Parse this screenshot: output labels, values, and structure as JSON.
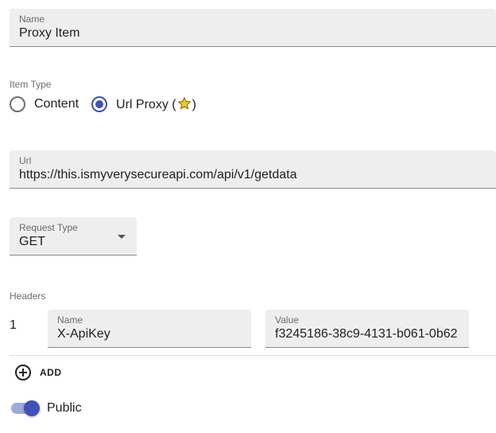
{
  "name_field": {
    "label": "Name",
    "value": "Proxy Item"
  },
  "item_type": {
    "label": "Item Type",
    "options": [
      {
        "label": "Content",
        "checked": false
      },
      {
        "label_prefix": "Url Proxy (",
        "label_suffix": ")",
        "icon": "star-icon",
        "checked": true
      }
    ]
  },
  "url_field": {
    "label": "Url",
    "value": "https://this.ismyverysecureapi.com/api/v1/getdata"
  },
  "request_type": {
    "label": "Request Type",
    "value": "GET"
  },
  "headers": {
    "label": "Headers",
    "rows": [
      {
        "index": "1",
        "name_label": "Name",
        "name_value": "X-ApiKey",
        "value_label": "Value",
        "value_value": "f3245186-38c9-4131-b061-0b62"
      }
    ],
    "add_label": "ADD"
  },
  "public_toggle": {
    "label": "Public",
    "on": true
  },
  "colors": {
    "accent": "#3f51b5",
    "track": "#9fa8da",
    "field_bg": "#eeeeee",
    "star": "#f4c430"
  }
}
